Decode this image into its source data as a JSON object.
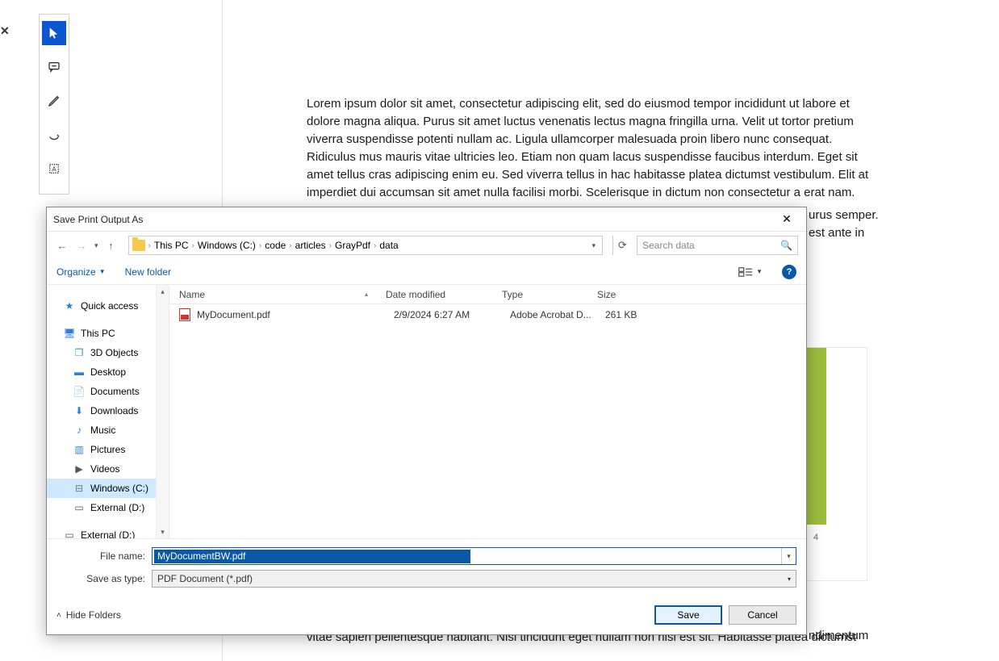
{
  "toolbar": {
    "items": [
      "cursor",
      "chat",
      "pencil",
      "erase",
      "textselect"
    ]
  },
  "document": {
    "para1": "Lorem ipsum dolor sit amet, consectetur adipiscing elit, sed do eiusmod tempor incididunt ut labore et dolore magna aliqua. Purus sit amet luctus venenatis lectus magna fringilla urna. Velit ut tortor pretium viverra suspendisse potenti nullam ac. Ligula ullamcorper malesuada proin libero nunc consequat. Ridiculus mus mauris vitae ultricies leo. Etiam non quam lacus suspendisse faucibus interdum. Eget sit amet tellus cras adipiscing enim eu. Sed viverra tellus in hac habitasse platea dictumst vestibulum. Elit at imperdiet dui accumsan sit amet nulla facilisi morbi. Scelerisque in dictum non consectetur a erat nam.",
    "cut_line1": "urus semper.",
    "cut_line2": "est ante in",
    "para_bottom": "vitae sapien pellentesque habitant. Nisl tincidunt eget nullam non nisi est sit. Habitasse platea dictumst",
    "para_bottom_lead": "ndimentum",
    "chart_x_label": "4"
  },
  "dialog": {
    "title": "Save Print Output As",
    "breadcrumb": [
      "This PC",
      "Windows (C:)",
      "code",
      "articles",
      "GrayPdf",
      "data"
    ],
    "search_placeholder": "Search data",
    "commands": {
      "organize": "Organize",
      "newfolder": "New folder"
    },
    "columns": {
      "name": "Name",
      "date": "Date modified",
      "type": "Type",
      "size": "Size"
    },
    "files": [
      {
        "name": "MyDocument.pdf",
        "date": "2/9/2024 6:27 AM",
        "type": "Adobe Acrobat D...",
        "size": "261 KB"
      }
    ],
    "nav": {
      "quick": "Quick access",
      "thispc": "This PC",
      "children": [
        "3D Objects",
        "Desktop",
        "Documents",
        "Downloads",
        "Music",
        "Pictures",
        "Videos",
        "Windows (C:)",
        "External (D:)"
      ],
      "ext2": "External (D:)"
    },
    "footer": {
      "filename_label": "File name:",
      "filename_value": "MyDocumentBW.pdf",
      "type_label": "Save as type:",
      "type_value": "PDF Document (*.pdf)",
      "hide": "Hide Folders",
      "save": "Save",
      "cancel": "Cancel"
    }
  }
}
